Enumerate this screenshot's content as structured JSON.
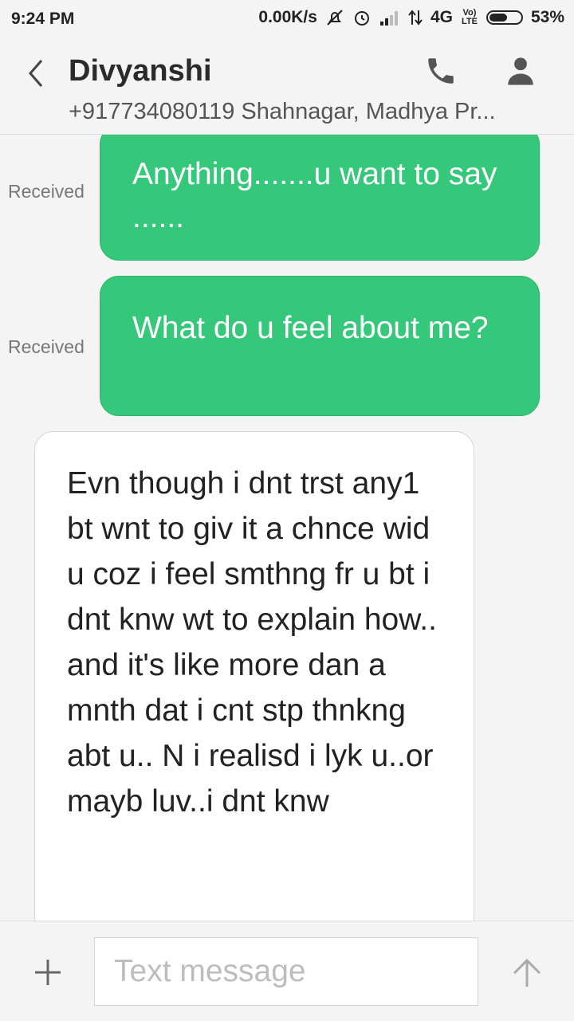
{
  "status_bar": {
    "time": "9:24 PM",
    "net_speed": "0.00K/s",
    "network": "4G",
    "lte_badge_top": "Vo)",
    "lte_badge_bottom": "LTE",
    "battery": "53%",
    "battery_level": 0.53
  },
  "header": {
    "contact_name": "Divyanshi",
    "contact_info": "+917734080119 Shahnagar, Madhya Pr..."
  },
  "messages": [
    {
      "label": "Received",
      "text": "Anything.......u want to say ......"
    },
    {
      "label": "Received",
      "text": "What do u feel about me?"
    },
    {
      "text": "Evn though i dnt trst any1 bt wnt to giv it a chnce wid u coz i feel smthng fr u bt i dnt knw wt to explain how..\nand it's like more dan a mnth dat i cnt stp thnkng abt u.. N i realisd i lyk u..or mayb luv..i dnt knw"
    }
  ],
  "composer": {
    "placeholder": "Text message"
  },
  "colors": {
    "sent_bubble": "#35c77a",
    "background": "#f4f4f4"
  },
  "icons": {
    "back": "chevron-left-icon",
    "call": "phone-icon",
    "profile": "person-icon",
    "attach": "plus-icon",
    "send": "arrow-up-icon"
  }
}
